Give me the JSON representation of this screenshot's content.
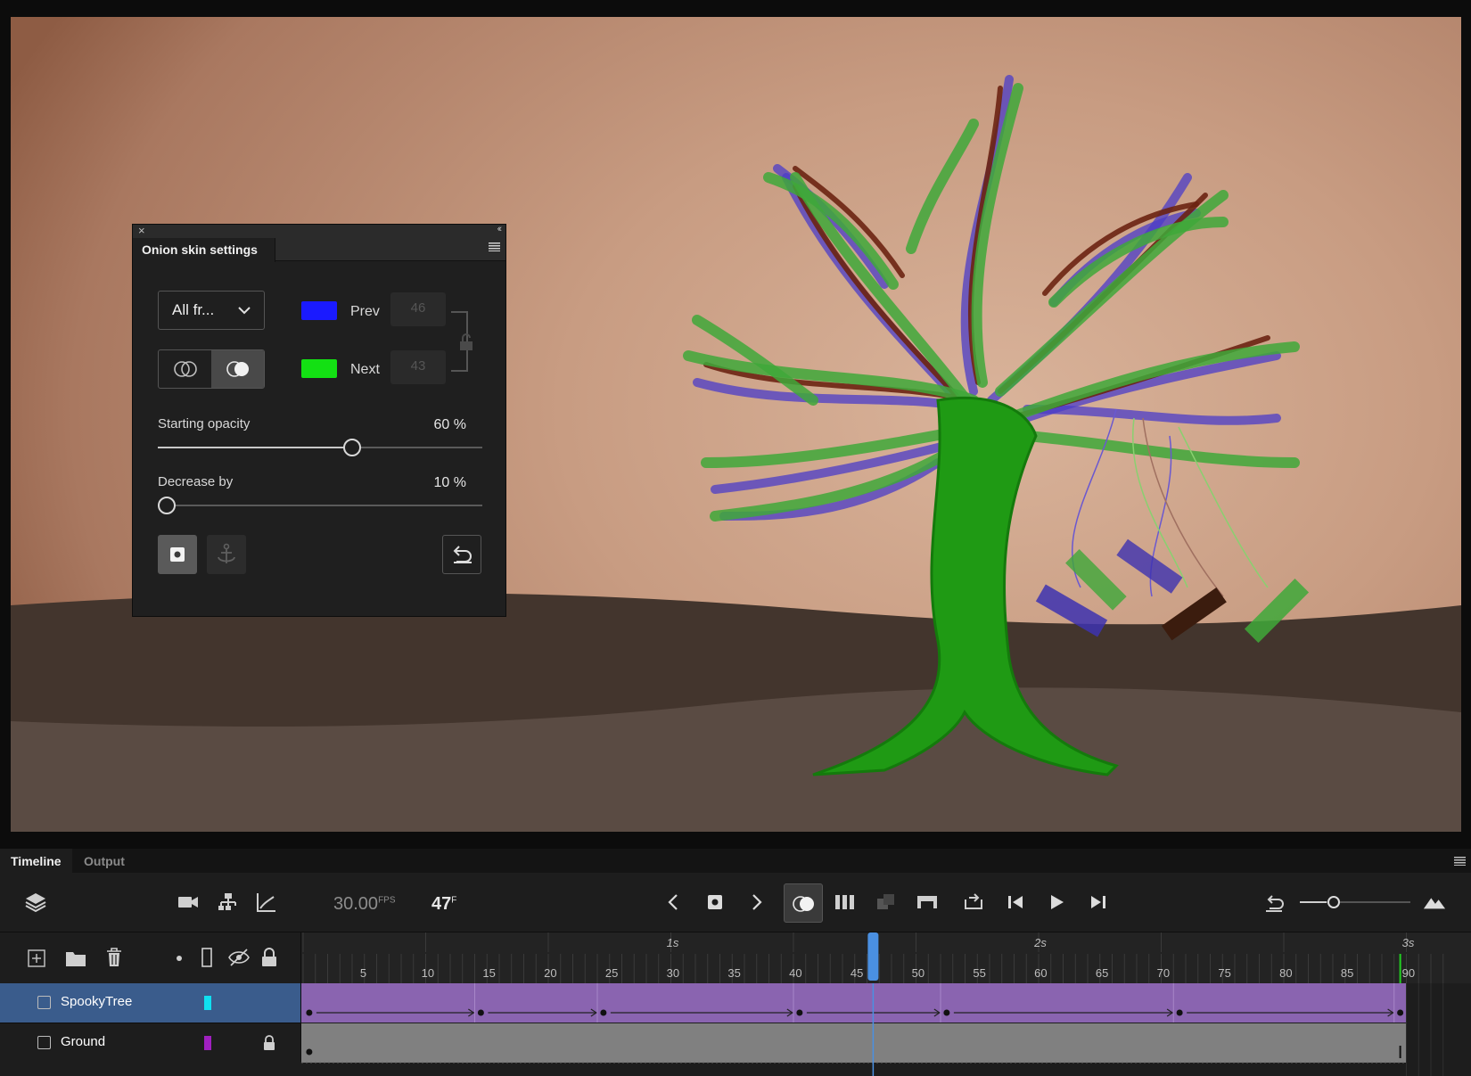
{
  "onion_panel": {
    "title": "Onion skin settings",
    "mode_dropdown": "All fr...",
    "prev_label": "Prev",
    "prev_color": "#1a1aff",
    "prev_value": "46",
    "next_label": "Next",
    "next_color": "#13e013",
    "next_value": "43",
    "starting_opacity_label": "Starting opacity",
    "starting_opacity_value": "60 %",
    "starting_opacity_fraction": 0.6,
    "decrease_by_label": "Decrease by",
    "decrease_by_value": "10 %",
    "decrease_by_fraction": 0.0
  },
  "timeline": {
    "tabs": [
      "Timeline",
      "Output"
    ],
    "fps_value": "30.00",
    "fps_unit": "FPS",
    "current_frame": "47",
    "frame_unit": "F",
    "ruler_seconds": [
      "1s",
      "2s",
      "3s"
    ],
    "ruler_frames": [
      "5",
      "10",
      "15",
      "20",
      "25",
      "30",
      "35",
      "40",
      "45",
      "50",
      "55",
      "60",
      "65",
      "70",
      "75",
      "80",
      "85",
      "90"
    ],
    "total_frames": 90,
    "playhead_frame": 47,
    "layers": [
      {
        "name": "SpookyTree",
        "color": "#10e0f0",
        "selected": true,
        "locked": false
      },
      {
        "name": "Ground",
        "color": "#a020c0",
        "selected": false,
        "locked": true
      }
    ],
    "keyframes": [
      1,
      15,
      25,
      41,
      53,
      72,
      90
    ]
  }
}
